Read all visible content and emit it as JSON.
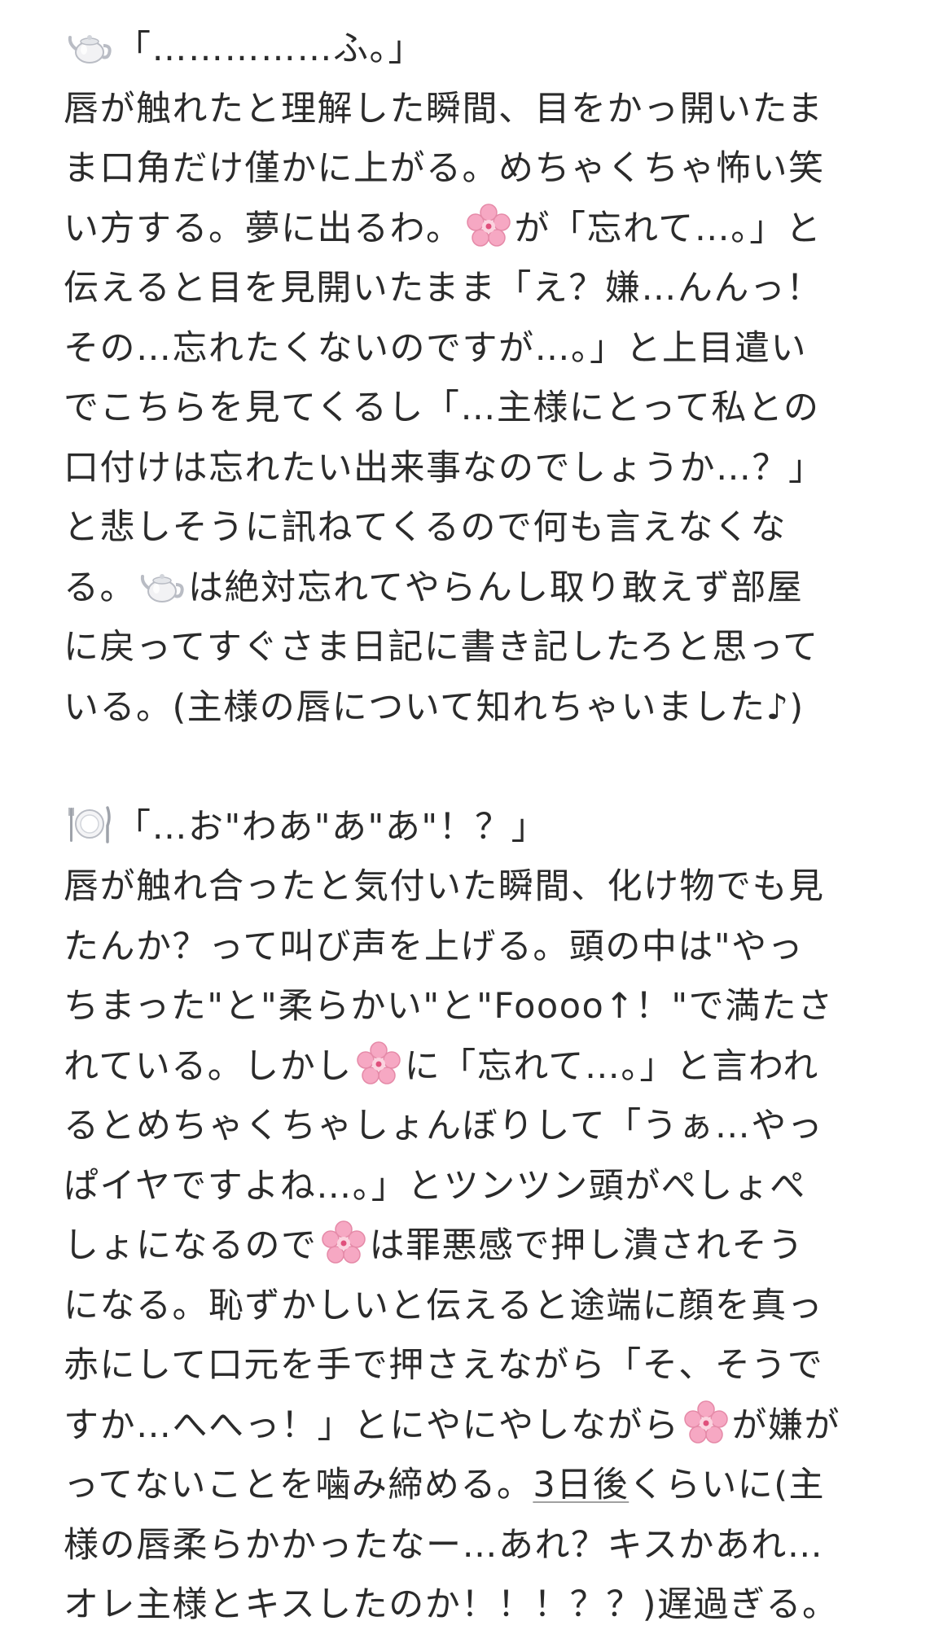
{
  "paragraph1": {
    "icon": "teapot-icon",
    "lines": [
      "「……………ふ。」",
      "唇が触れたと理解した瞬間、目をかっ開いたま",
      "ま口角だけ僅かに上がる。めちゃくちゃ怖い笑",
      [
        "い方する。夢に出るわ。",
        "が「忘れて…。」と"
      ],
      "伝えると目を見開いたまま「え？嫌…んんっ！",
      "その…忘れたくないのですが…。」と上目遣い",
      "でこちらを見てくるし「…主様にとって私との",
      "口付けは忘れたい出来事なのでしょうか…？」",
      "と悲しそうに訊ねてくるので何も言えなくな",
      [
        "る。",
        "は絶対忘れてやらんし取り敢えず部屋"
      ],
      "に戻ってすぐさま日記に書き記したろと思って",
      "いる。(主様の唇について知れちゃいました♪)"
    ]
  },
  "paragraph2": {
    "icon": "plate-cutlery-icon",
    "lines": [
      "「…お\"わあ\"あ\"あ\"！？」",
      "唇が触れ合ったと気付いた瞬間、化け物でも見",
      "たんか？って叫び声を上げる。頭の中は\"やっ",
      "ちまった\"と\"柔らかい\"と\"Foooo↑！\"で満たさ",
      [
        "れている。しかし",
        "に「忘れて…。」と言われ"
      ],
      "るとめちゃくちゃしょんぼりして「うぁ…やっ",
      "ぱイヤですよね…。」とツンツン頭がぺしょぺ",
      [
        "しょになるので",
        "は罪悪感で押し潰されそう"
      ],
      "になる。恥ずかしいと伝えると途端に顔を真っ",
      "赤にして口元を手で押さえながら「そ、そうで",
      [
        "すか…へへっ！」とにやにやしながら",
        "が嫌が"
      ],
      [
        "ってないことを噛み締める。",
        "3日後",
        "くらいに(主"
      ],
      "様の唇柔らかかったなー…あれ？キスかあれ…",
      "オレ主様とキスしたのか！！！？？)遅過ぎる。"
    ]
  },
  "colors": {
    "text": "#2b2b2b",
    "blossom": "#f6a8c3",
    "underline": "#a0a0a0"
  }
}
